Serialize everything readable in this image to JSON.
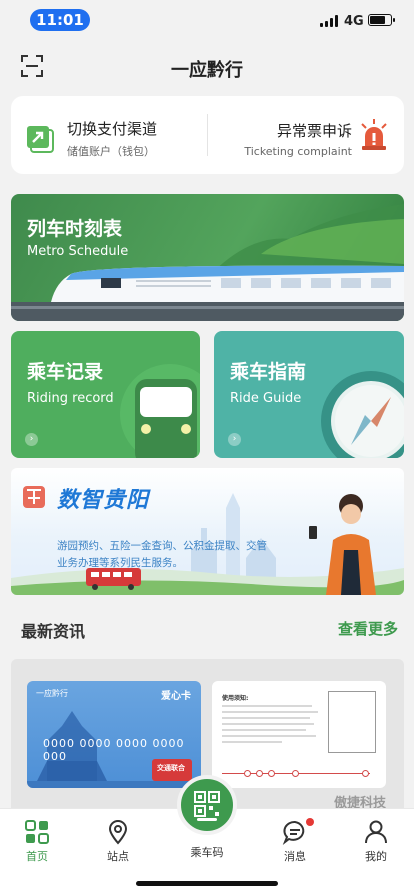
{
  "status": {
    "time": "11:01",
    "network": "4G",
    "battery_level": 0.7
  },
  "header": {
    "title": "一应黔行",
    "scan_icon": "scan-icon"
  },
  "quick_actions": {
    "switch": {
      "title": "切换支付渠道",
      "subtitle": "储值账户（钱包）",
      "icon": "switch-arrow-icon"
    },
    "complaint": {
      "title": "异常票申诉",
      "subtitle": "Ticketing complaint",
      "icon": "alarm-icon"
    }
  },
  "cards": {
    "metro": {
      "title": "列车时刻表",
      "subtitle": "Metro Schedule"
    },
    "ride": {
      "title": "乘车记录",
      "subtitle": "Riding record"
    },
    "guide": {
      "title": "乘车指南",
      "subtitle": "Ride Guide"
    }
  },
  "promo": {
    "title": "数智贵阳",
    "text": "游园预约、五险一金查询、公积金提取、交管业务办理等系列民生服务。"
  },
  "news": {
    "title": "最新资讯",
    "more": "查看更多",
    "card_front": {
      "brand": "一应黔行",
      "name": "爱心卡",
      "number": "0000 0000 0000 0000 000",
      "tag": "交通联合"
    },
    "card_back": {
      "title": "使用须知:"
    },
    "watermark": "傲捷科技"
  },
  "tabs": [
    {
      "label": "首页",
      "icon": "home-grid-icon",
      "active": true
    },
    {
      "label": "站点",
      "icon": "location-pin-icon",
      "active": false
    },
    {
      "label": "乘车码",
      "icon": "qr-code-icon",
      "active": false
    },
    {
      "label": "消息",
      "icon": "chat-bubble-icon",
      "active": false,
      "badge": true
    },
    {
      "label": "我的",
      "icon": "user-icon",
      "active": false
    }
  ],
  "colors": {
    "primary_green": "#3e9a4e",
    "blue_accent": "#1f78d6",
    "alert_red": "#e53935"
  }
}
